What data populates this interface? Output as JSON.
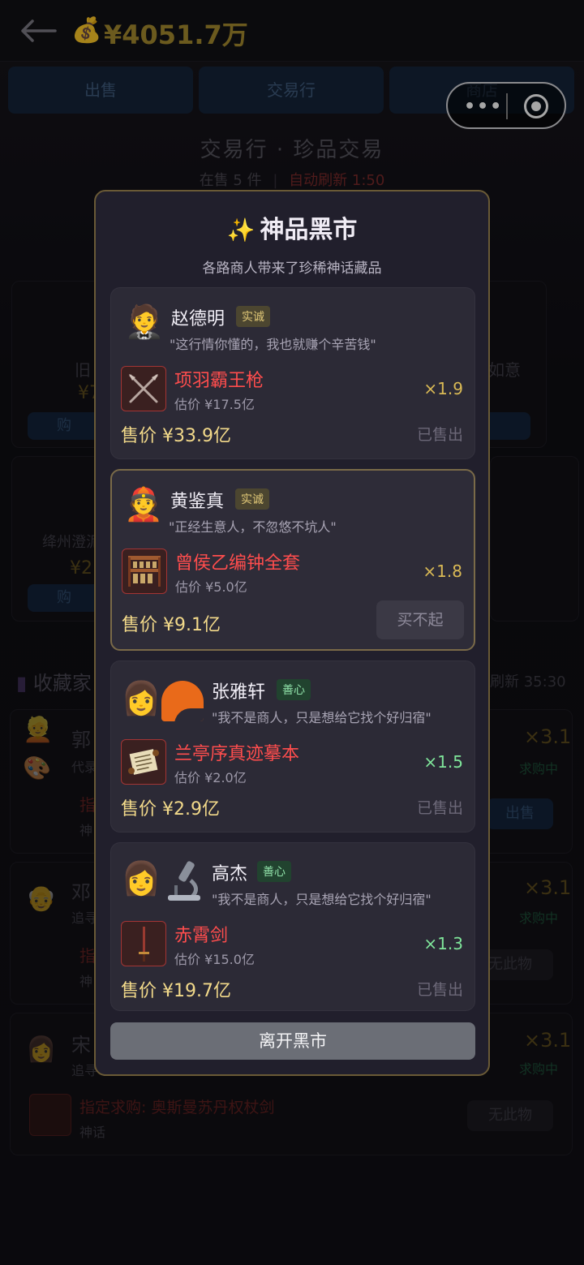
{
  "header": {
    "money": "¥4051.7万"
  },
  "tabs": [
    "出售",
    "交易行",
    "商店"
  ],
  "page": {
    "title": "交易行 · 珍品交易",
    "on_sale": "在售 5 件",
    "separator": "|",
    "refresh": "自动刷新 1:50"
  },
  "background": {
    "card1_label": "旧",
    "card1_price": "¥7",
    "card1_btn": "购",
    "card1_right": "如意",
    "card2_label": "绛州澄泥",
    "card2_price": "¥2",
    "card2_btn": "购",
    "collectors_title": "收藏家",
    "collectors_refresh": "刷新 35:30",
    "c1_name": "郭",
    "c1_sub": "代录",
    "c1_req": "指",
    "c1_req_sub": "神",
    "c1_mult": "×3.1",
    "c1_status": "求购中",
    "c1_btn": "出售",
    "c2_name": "邓",
    "c2_sub": "追寻",
    "c2_req": "指",
    "c2_req_sub": "神",
    "c2_mult": "×3.1",
    "c2_status": "求购中",
    "c2_btn": "无此物",
    "c3_name": "宋",
    "c3_sub": "追寻",
    "c3_req": "指定求购: 奥斯曼苏丹权杖剑",
    "c3_req_sub": "神话",
    "c3_mult": "×3.1",
    "c3_status": "求购中",
    "c3_btn": "无此物"
  },
  "modal": {
    "spark": "✨",
    "title": "神品黑市",
    "subtitle": "各路商人带来了珍稀神话藏品",
    "price_prefix": "售价",
    "est_prefix": "估价",
    "leave": "离开黑市",
    "merchants": [
      {
        "avatar": "🤵",
        "name": "赵德明",
        "badge": "实诚",
        "quote": "\"这行情你懂的，我也就赚个辛苦钱\"",
        "item_icon": "crossed-spears-icon",
        "item": "项羽霸王枪",
        "estimate": "估价 ¥17.5亿",
        "multiplier": "×1.9",
        "price": "售价 ¥33.9亿",
        "status": "已售出"
      },
      {
        "avatar": "👲",
        "name": "黄鉴真",
        "badge": "实诚",
        "quote": "\"正经生意人，不忽悠不坑人\"",
        "item_icon": "bells-icon",
        "item": "曾侯乙编钟全套",
        "estimate": "估价 ¥5.0亿",
        "multiplier": "×1.8",
        "price": "售价 ¥9.1亿",
        "status": "买不起"
      },
      {
        "avatar": "👩",
        "name": "张雅轩",
        "badge": "善心",
        "quote": "\"我不是商人，只是想给它找个好归宿\"",
        "item_icon": "scroll-icon",
        "item": "兰亭序真迹摹本",
        "estimate": "估价 ¥2.0亿",
        "multiplier": "×1.5",
        "price": "售价 ¥2.9亿",
        "status": "已售出"
      },
      {
        "avatar": "👩",
        "name": "高杰",
        "badge": "善心",
        "quote": "\"我不是商人，只是想给它找个好归宿\"",
        "item_icon": "sword-icon",
        "item": "赤霄剑",
        "estimate": "估价 ¥15.0亿",
        "multiplier": "×1.3",
        "price": "售价 ¥19.7亿",
        "status": "已售出"
      }
    ]
  }
}
